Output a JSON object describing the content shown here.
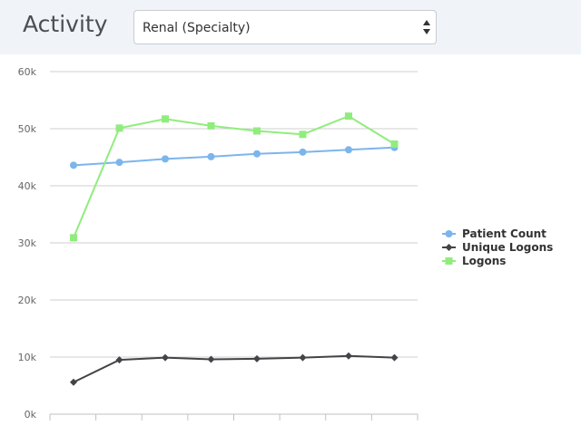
{
  "header": {
    "title": "Activity",
    "selected_option": "Renal  (Specialty)"
  },
  "chart_data": {
    "type": "line",
    "x": [
      1,
      2,
      3,
      4,
      5,
      6,
      7,
      8
    ],
    "ylim": [
      0,
      60000
    ],
    "yticks": [
      "0k",
      "10k",
      "20k",
      "30k",
      "40k",
      "50k",
      "60k"
    ],
    "grid": true,
    "legend_position": "right",
    "series": [
      {
        "name": "Patient Count",
        "color": "#7cb5ec",
        "marker": "circle",
        "values": [
          43600,
          44100,
          44700,
          45100,
          45600,
          45900,
          46300,
          46700
        ]
      },
      {
        "name": "Unique Logons",
        "color": "#434348",
        "marker": "diamond",
        "values": [
          5600,
          9500,
          9900,
          9600,
          9700,
          9900,
          10200,
          9900
        ]
      },
      {
        "name": "Logons",
        "color": "#90ed7d",
        "marker": "square",
        "values": [
          30900,
          50100,
          51700,
          50500,
          49600,
          49000,
          52200,
          47300
        ]
      }
    ]
  }
}
